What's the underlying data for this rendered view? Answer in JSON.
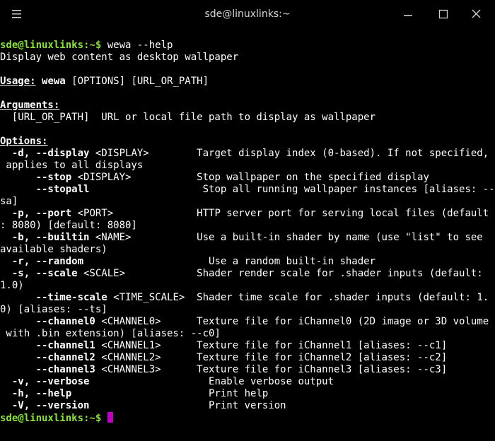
{
  "window": {
    "title": "sde@linuxlinks:~"
  },
  "icons": [
    "menu-icon",
    "minimize-icon",
    "maximize-icon",
    "close-icon"
  ],
  "colors": {
    "background": "#000000",
    "prompt": "#8ae234",
    "text": "#ffffff",
    "cursor": "#c000c0"
  },
  "terminal": {
    "prompt": "sde@linuxlinks:~$",
    "command": " wewa --help",
    "description": "Display web content as desktop wallpaper",
    "usage_label": "Usage:",
    "usage_cmd": "wewa",
    "usage_args": " [OPTIONS] [URL_OR_PATH]",
    "arguments_label": "Arguments:",
    "argument_line": "  [URL_OR_PATH]  URL or local file path to display as wallpaper",
    "options_label": "Options:",
    "option_lines": [
      [
        [
          "  ",
          ""
        ],
        [
          "-d, --display",
          "b"
        ],
        [
          " <DISPLAY>        Target display index (0-based). If not specified,",
          ""
        ]
      ],
      [
        [
          " applies to all displays",
          ""
        ]
      ],
      [
        [
          "      ",
          ""
        ],
        [
          "--stop",
          "b"
        ],
        [
          " <DISPLAY>           Stop wallpaper on the specified display",
          ""
        ]
      ],
      [
        [
          "      ",
          ""
        ],
        [
          "--stopall",
          "b"
        ],
        [
          "                   Stop all running wallpaper instances [aliases: --",
          ""
        ]
      ],
      [
        [
          "sa]",
          ""
        ]
      ],
      [
        [
          "  ",
          ""
        ],
        [
          "-p, --port",
          "b"
        ],
        [
          " <PORT>              HTTP server port for serving local files (default",
          ""
        ]
      ],
      [
        [
          ": 8080) [default: 8080]",
          ""
        ]
      ],
      [
        [
          "  ",
          ""
        ],
        [
          "-b, --builtin",
          "b"
        ],
        [
          " <NAME>           Use a built-in shader by name (use \"list\" to see",
          ""
        ]
      ],
      [
        [
          "available shaders)",
          ""
        ]
      ],
      [
        [
          "  ",
          ""
        ],
        [
          "-r, --random",
          "b"
        ],
        [
          "                     Use a random built-in shader",
          ""
        ]
      ],
      [
        [
          "  ",
          ""
        ],
        [
          "-s, --scale",
          "b"
        ],
        [
          " <SCALE>            Shader render scale for .shader inputs (default:",
          ""
        ]
      ],
      [
        [
          "1.0)",
          ""
        ]
      ],
      [
        [
          "      ",
          ""
        ],
        [
          "--time-scale",
          "b"
        ],
        [
          " <TIME_SCALE>  Shader time scale for .shader inputs (default: 1.",
          ""
        ]
      ],
      [
        [
          "0) [aliases: --ts]",
          ""
        ]
      ],
      [
        [
          "      ",
          ""
        ],
        [
          "--channel0",
          "b"
        ],
        [
          " <CHANNEL0>      Texture file for iChannel0 (2D image or 3D volume",
          ""
        ]
      ],
      [
        [
          " with .bin extension) [aliases: --c0]",
          ""
        ]
      ],
      [
        [
          "      ",
          ""
        ],
        [
          "--channel1",
          "b"
        ],
        [
          " <CHANNEL1>      Texture file for iChannel1 [aliases: --c1]",
          ""
        ]
      ],
      [
        [
          "      ",
          ""
        ],
        [
          "--channel2",
          "b"
        ],
        [
          " <CHANNEL2>      Texture file for iChannel2 [aliases: --c2]",
          ""
        ]
      ],
      [
        [
          "      ",
          ""
        ],
        [
          "--channel3",
          "b"
        ],
        [
          " <CHANNEL3>      Texture file for iChannel3 [aliases: --c3]",
          ""
        ]
      ],
      [
        [
          "  ",
          ""
        ],
        [
          "-v, --verbose",
          "b"
        ],
        [
          "                    Enable verbose output",
          ""
        ]
      ],
      [
        [
          "  ",
          ""
        ],
        [
          "-h, --help",
          "b"
        ],
        [
          "                       Print help",
          ""
        ]
      ],
      [
        [
          "  ",
          ""
        ],
        [
          "-V, --version",
          "b"
        ],
        [
          "                    Print version",
          ""
        ]
      ]
    ]
  }
}
